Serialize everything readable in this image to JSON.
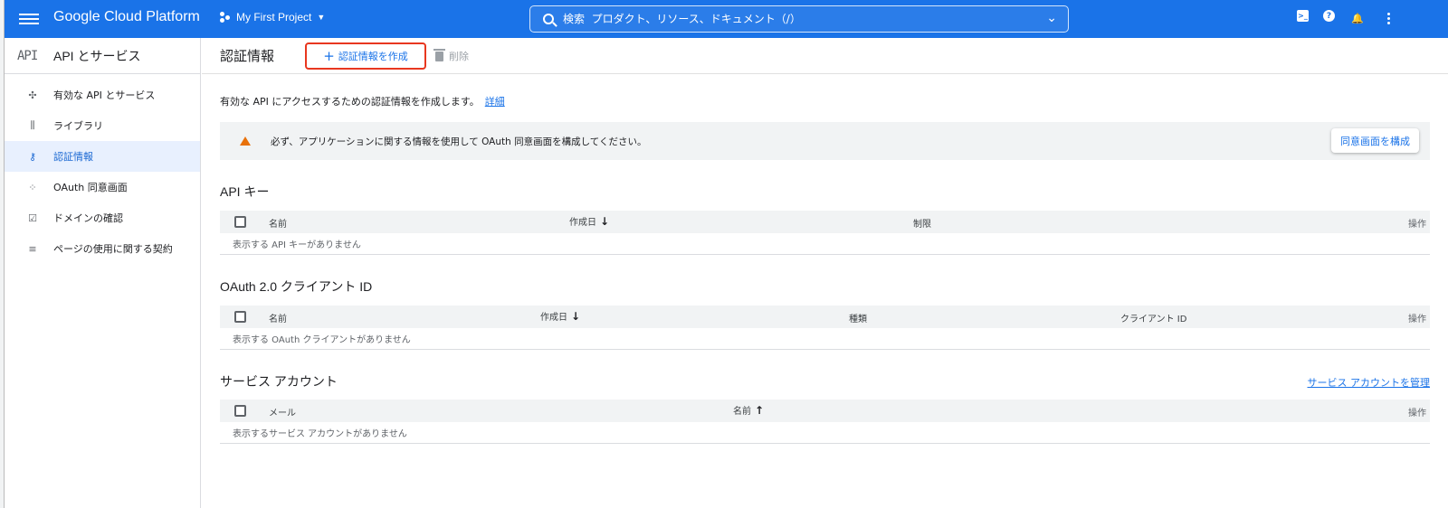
{
  "topbar": {
    "brand": "Google Cloud Platform",
    "project": "My First Project",
    "search_placeholder": "検索  プロダクト、リソース、ドキュメント（/）",
    "accent": "#1a73e8"
  },
  "sidebar": {
    "logo": "API",
    "title": "API とサービス",
    "items": [
      {
        "label": "有効な API とサービス",
        "icon": "api-services-icon"
      },
      {
        "label": "ライブラリ",
        "icon": "library-icon"
      },
      {
        "label": "認証情報",
        "icon": "key-icon",
        "active": true
      },
      {
        "label": "OAuth 同意画面",
        "icon": "consent-icon"
      },
      {
        "label": "ドメインの確認",
        "icon": "domain-check-icon"
      },
      {
        "label": "ページの使用に関する契約",
        "icon": "page-agreement-icon"
      }
    ]
  },
  "main": {
    "title": "認証情報",
    "create_label": "認証情報を作成",
    "delete_label": "削除",
    "intro": "有効な API にアクセスするための認証情報を作成します。",
    "intro_link": "詳細",
    "banner": {
      "text": "必ず、アプリケーションに関する情報を使用して OAuth 同意画面を構成してください。",
      "button": "同意画面を構成"
    },
    "api_keys": {
      "title": "API キー",
      "columns": [
        "名前",
        "作成日",
        "制限",
        "操作"
      ],
      "empty": "表示する API キーがありません"
    },
    "oauth": {
      "title": "OAuth 2.0 クライアント ID",
      "columns": [
        "名前",
        "作成日",
        "種類",
        "クライアント ID",
        "操作"
      ],
      "empty": "表示する OAuth クライアントがありません"
    },
    "service_accounts": {
      "title": "サービス アカウント",
      "manage_link": "サービス アカウントを管理",
      "columns": [
        "メール",
        "名前",
        "操作"
      ],
      "empty": "表示するサービス アカウントがありません"
    }
  }
}
